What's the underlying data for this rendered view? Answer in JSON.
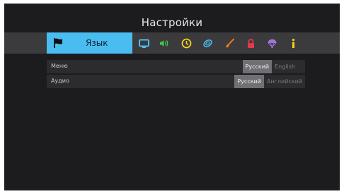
{
  "window": {
    "title": "Настройки"
  },
  "tabs": {
    "active_label": "Язык",
    "icons": [
      {
        "name": "flag-icon",
        "color": "#111111"
      },
      {
        "name": "tv-screen-icon",
        "color": "#49bdef"
      },
      {
        "name": "volume-icon",
        "color": "#3fc94a"
      },
      {
        "name": "clock-icon",
        "color": "#f2d21a"
      },
      {
        "name": "network-icon",
        "color": "#49bdef"
      },
      {
        "name": "brush-icon",
        "color": "#f07a1c"
      },
      {
        "name": "lock-icon",
        "color": "#e23a4b"
      },
      {
        "name": "parachute-icon",
        "color": "#a274d8"
      },
      {
        "name": "info-icon",
        "color": "#f2d21a"
      }
    ]
  },
  "settings": {
    "menu": {
      "label": "Меню",
      "options": [
        "Русский",
        "English"
      ],
      "selected": "Русский"
    },
    "audio": {
      "label": "Аудио",
      "options": [
        "Русский",
        "Английский"
      ],
      "selected": "Русский"
    }
  }
}
